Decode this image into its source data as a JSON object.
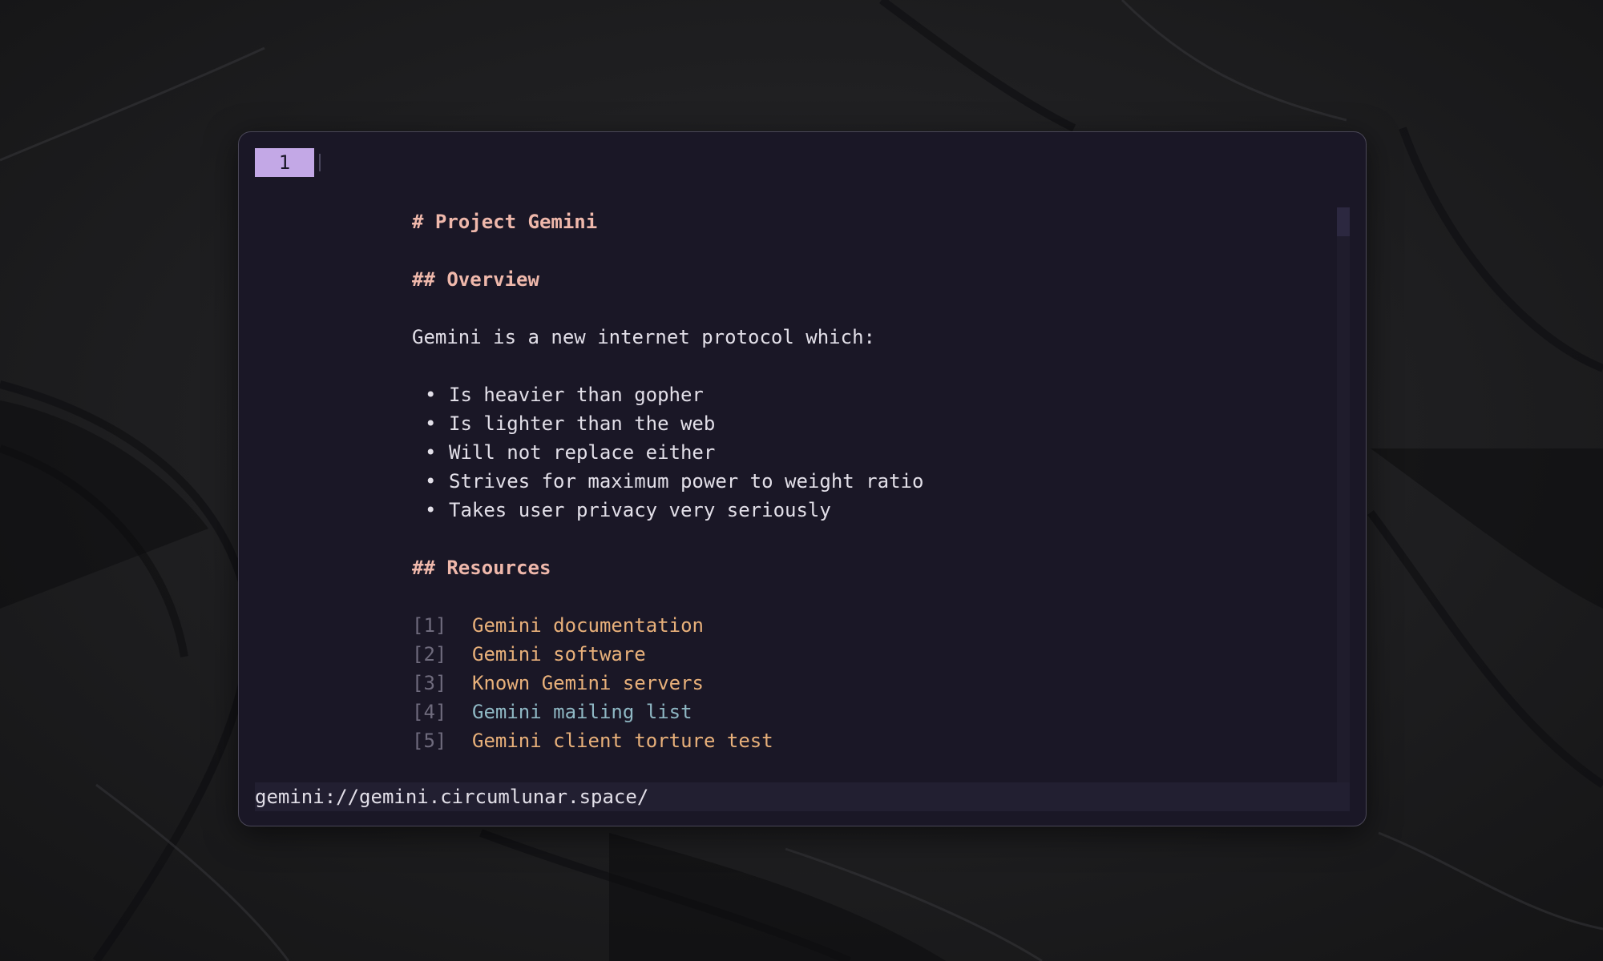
{
  "tabs": [
    {
      "label": "1"
    }
  ],
  "page": {
    "title": "# Project Gemini",
    "overview_heading": "## Overview",
    "intro": "Gemini is a new internet protocol which:",
    "bullets": [
      "Is heavier than gopher",
      "Is lighter than the web",
      "Will not replace either",
      "Strives for maximum power to weight ratio",
      "Takes user privacy very seriously"
    ],
    "resources_heading": "## Resources",
    "links": [
      {
        "ref": "[1]",
        "text": "Gemini documentation"
      },
      {
        "ref": "[2]",
        "text": "Gemini software"
      },
      {
        "ref": "[3]",
        "text": "Known Gemini servers"
      },
      {
        "ref": "[4]",
        "text": "Gemini mailing list"
      },
      {
        "ref": "[5]",
        "text": "Gemini client torture test"
      }
    ]
  },
  "statusbar": {
    "url": "gemini://gemini.circumlunar.space/"
  },
  "colors": {
    "background": "#1a1726",
    "tab_active": "#c3a8e6",
    "heading": "#efb8ab",
    "link": "#e8b07a",
    "link_visited": "#8fb8c4",
    "link_ref": "#6f6b7d",
    "text": "#e2dfe8"
  },
  "icons": {
    "bullet": "•"
  }
}
